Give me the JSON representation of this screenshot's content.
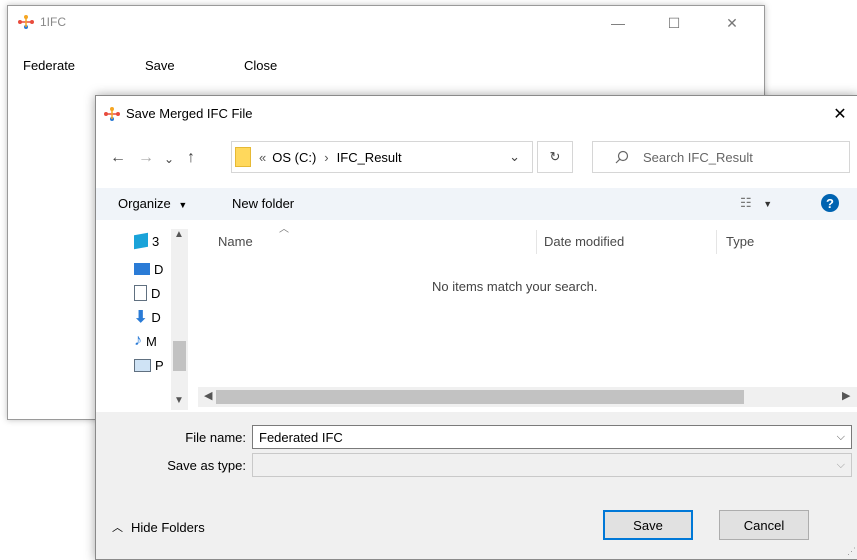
{
  "app": {
    "title": "1IFC",
    "menu": [
      "Federate",
      "Save",
      "Close"
    ],
    "controls": {
      "minimize": "—",
      "maximize": "☐",
      "close": "✕"
    }
  },
  "dialog": {
    "title": "Save Merged IFC File",
    "close": "✕",
    "nav": {
      "back": "←",
      "forward": "→",
      "recent": "⌄",
      "up": "↑"
    },
    "address": {
      "overflow": "«",
      "path": [
        "OS (C:)",
        "IFC_Result"
      ],
      "separator": "›",
      "dropdown": "⌄"
    },
    "refresh": "↻",
    "search_placeholder": "Search IFC_Result",
    "toolbar": {
      "organize": "Organize",
      "new_folder": "New folder",
      "view": "☷",
      "help": "?"
    },
    "nav_pane_items": [
      {
        "label": "3",
        "icon": "3d-objects-icon",
        "color": "#1aa3d9"
      },
      {
        "label": "D",
        "icon": "desktop-icon",
        "color": "#2a7bd6"
      },
      {
        "label": "D",
        "icon": "documents-icon",
        "color": "#607080"
      },
      {
        "label": "D",
        "icon": "downloads-icon",
        "color": "#2a7bd6"
      },
      {
        "label": "M",
        "icon": "music-icon",
        "color": "#2a7bd6"
      },
      {
        "label": "P",
        "icon": "pictures-icon",
        "color": "#607080"
      }
    ],
    "columns": [
      "Name",
      "Date modified",
      "Type"
    ],
    "empty_message": "No items match your search.",
    "file_name_label": "File name:",
    "file_name_value": "Federated IFC",
    "save_type_label": "Save as type:",
    "save_type_value": "",
    "hide_folders": "Hide Folders",
    "save_button": "Save",
    "cancel_button": "Cancel"
  },
  "colors": {
    "accent": "#0078d7",
    "folder": "#ffd85c",
    "help": "#0063b1"
  }
}
